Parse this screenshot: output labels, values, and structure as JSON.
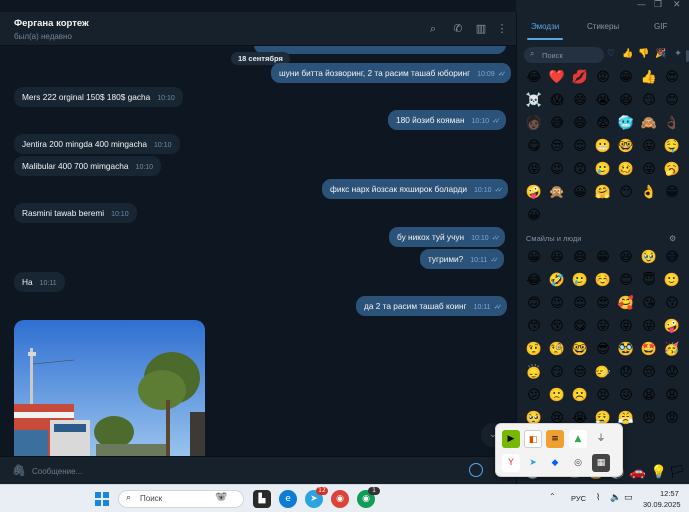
{
  "chat": {
    "title": "Фергана кортеж",
    "status": "был(а) недавно",
    "date_separator": "18 сентября",
    "messages": [
      {
        "dir": "out",
        "text": "",
        "time": "10:09",
        "read": true
      },
      {
        "dir": "out",
        "text": "шуни битта йозворинг, 2 та расим ташаб юборинг",
        "time": "10:09",
        "read": true
      },
      {
        "dir": "in",
        "text": "Mers 222 orginal 150$ 180$ gacha",
        "time": "10:10"
      },
      {
        "dir": "out",
        "text": "180 йозиб кояман",
        "time": "10:10",
        "read": true
      },
      {
        "dir": "in",
        "text": "Jentira 200 mingda 400 mingacha",
        "time": "10:10"
      },
      {
        "dir": "in",
        "text": "Malibular 400 700 mimgacha",
        "time": "10:10"
      },
      {
        "dir": "out",
        "text": "фикс нарх йозсак яхширок боларди",
        "time": "10:10",
        "read": true
      },
      {
        "dir": "in",
        "text": "Rasmini tawab beremi",
        "time": "10:10"
      },
      {
        "dir": "out",
        "text": "бу никох туй учун",
        "time": "10:10",
        "read": true
      },
      {
        "dir": "out",
        "text": "тугрими?",
        "time": "10:11",
        "read": true
      },
      {
        "dir": "in",
        "text": "Ha",
        "time": "10:11"
      },
      {
        "dir": "out",
        "text": "да 2 та расим ташаб коинг",
        "time": "10:11",
        "read": true
      }
    ],
    "composer_placeholder": "Сообщение..."
  },
  "emoji_panel": {
    "tabs": [
      "Эмодзи",
      "Стикеры",
      "GIF"
    ],
    "active_tab": "Эмодзи",
    "search_placeholder": "Поиск",
    "section_title": "Смайлы и люди",
    "recent": [
      "😂",
      "❤️",
      "💋",
      "😡",
      "😁",
      "👍",
      "😍",
      "☠️",
      "😱",
      "😄",
      "😭",
      "😆",
      "😏",
      "😊",
      "🧑🏿",
      "😅",
      "😄",
      "😨",
      "🥶",
      "🙈",
      "👌🏿",
      "😋",
      "😒",
      "😌",
      "😬",
      "🤓",
      "😛",
      "🤤",
      "😝",
      "😉",
      "😙",
      "🥲",
      "🥴",
      "😜",
      "🥱",
      "🤪",
      "🙊",
      "😀",
      "🤗",
      "😶",
      "👌",
      "😁",
      "😀"
    ],
    "smileys": [
      "😀",
      "😃",
      "😄",
      "😁",
      "😆",
      "🥹",
      "😅",
      "😂",
      "🤣",
      "🥲",
      "☺️",
      "😊",
      "😇",
      "🙂",
      "🙃",
      "😉",
      "😌",
      "😍",
      "🥰",
      "😘",
      "😗",
      "😙",
      "😚",
      "😋",
      "😛",
      "😝",
      "😜",
      "🤪",
      "🤨",
      "🧐",
      "🤓",
      "😎",
      "🥸",
      "🤩",
      "🥳",
      "🙂‍↕️",
      "😏",
      "😒",
      "🙂‍↔️",
      "😞",
      "😔",
      "😟",
      "😕",
      "🙁",
      "☹️",
      "😣",
      "😖",
      "😫",
      "😩",
      "🥺",
      "😢",
      "😭",
      "😮‍💨",
      "😤",
      "😠",
      "😡",
      "🤬"
    ]
  },
  "tray_popup": {
    "icons": [
      "nvidia-icon",
      "app-icon",
      "stack-icon",
      "drive-icon",
      "usb-icon",
      "ghost-icon",
      "yandex-icon",
      "telegram-icon",
      "dropbox-icon",
      "game-icon",
      "display-icon"
    ]
  },
  "taskbar": {
    "search_label": "Поиск",
    "language": "РУС",
    "time": "12:57",
    "date": "30.09.2025",
    "badges": {
      "telegram": "12",
      "chrome": "1"
    }
  }
}
